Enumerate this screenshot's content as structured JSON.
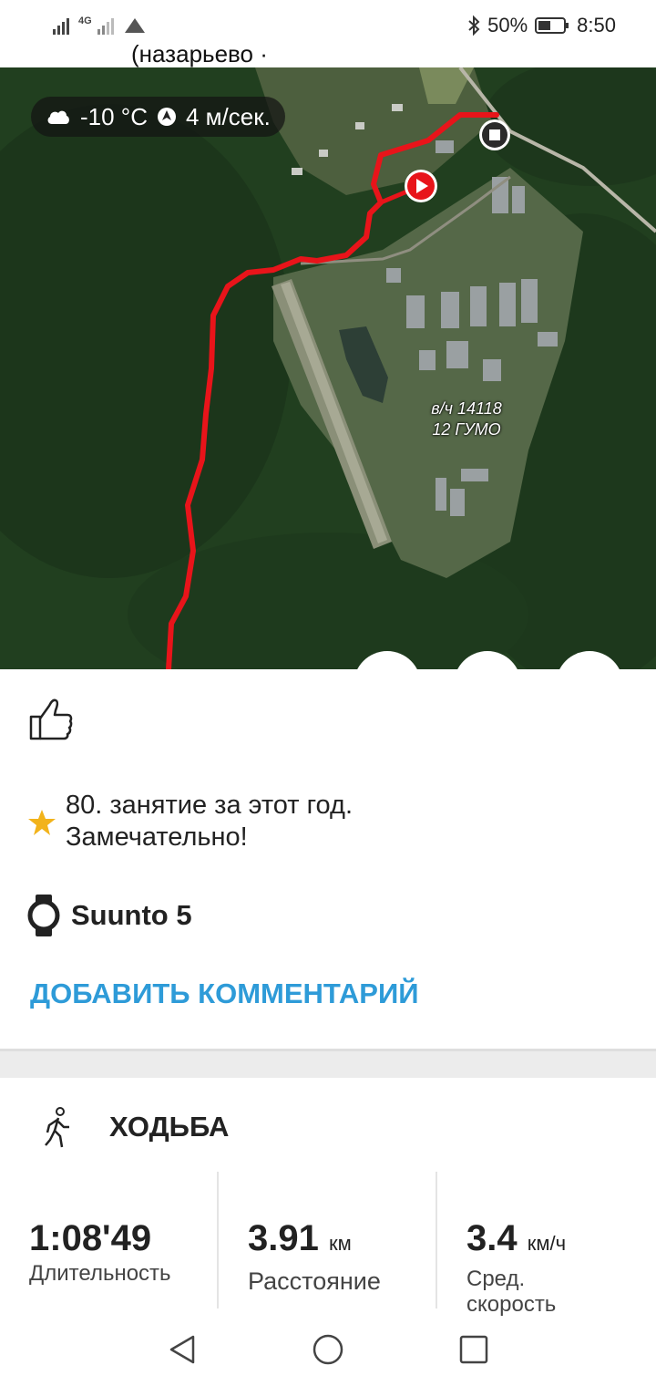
{
  "status_bar": {
    "network": "4G",
    "battery": "50%",
    "time": "8:50"
  },
  "map": {
    "location_fragment": "(назарьево ·",
    "weather": {
      "temperature": "-10 °C",
      "wind": "4 м/сек."
    },
    "label_line1": "в/ч 14118",
    "label_line2": "12 ГУМО",
    "route_color": "#e8141a"
  },
  "social": {
    "like_icon": "thumbs-up-icon"
  },
  "achievement": {
    "line1": "80. занятие за этот год.",
    "line2": "Замечательно!",
    "icon": "star-icon",
    "icon_color": "#f2b31b"
  },
  "device": {
    "name": "Suunto 5",
    "icon": "watch-icon"
  },
  "add_comment_label": "ДОБАВИТЬ КОММЕНТАРИЙ",
  "activity": {
    "type": "ХОДЬБА",
    "icon": "walking-person-icon",
    "stats": [
      {
        "value": "1:08'49",
        "unit": "",
        "label": "Длительность"
      },
      {
        "value": "3.91",
        "unit": "км",
        "label": "Расстояние"
      },
      {
        "value": "3.4",
        "unit": "км/ч",
        "label_line1": "Сред.",
        "label_line2": "скорость"
      }
    ]
  },
  "accent_color": "#2e9bd8"
}
